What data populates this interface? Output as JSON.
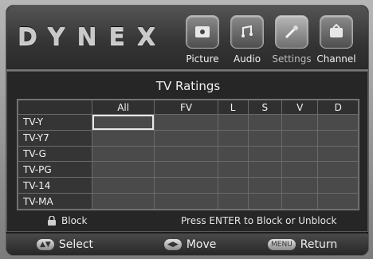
{
  "brand": {
    "logo_text": "DYNEX"
  },
  "menu_tabs": [
    {
      "label": "Picture",
      "icon": "picture-icon"
    },
    {
      "label": "Audio",
      "icon": "audio-icon"
    },
    {
      "label": "Settings",
      "icon": "settings-icon"
    },
    {
      "label": "Channel",
      "icon": "channel-icon"
    }
  ],
  "panel": {
    "title": "TV Ratings",
    "columns": [
      "All",
      "FV",
      "L",
      "S",
      "V",
      "D"
    ],
    "rows": [
      "TV-Y",
      "TV-Y7",
      "TV-G",
      "TV-PG",
      "TV-14",
      "TV-MA"
    ]
  },
  "hint": {
    "block_label": "Block",
    "message": "Press ENTER to Block or Unblock"
  },
  "footer": {
    "select_label": "Select",
    "move_label": "Move",
    "menu_key": "MENU",
    "return_label": "Return"
  },
  "colors": {
    "panel_bg": "#262626",
    "grid_cell": "#4a4a4a",
    "selection": "#e8e8e8"
  }
}
